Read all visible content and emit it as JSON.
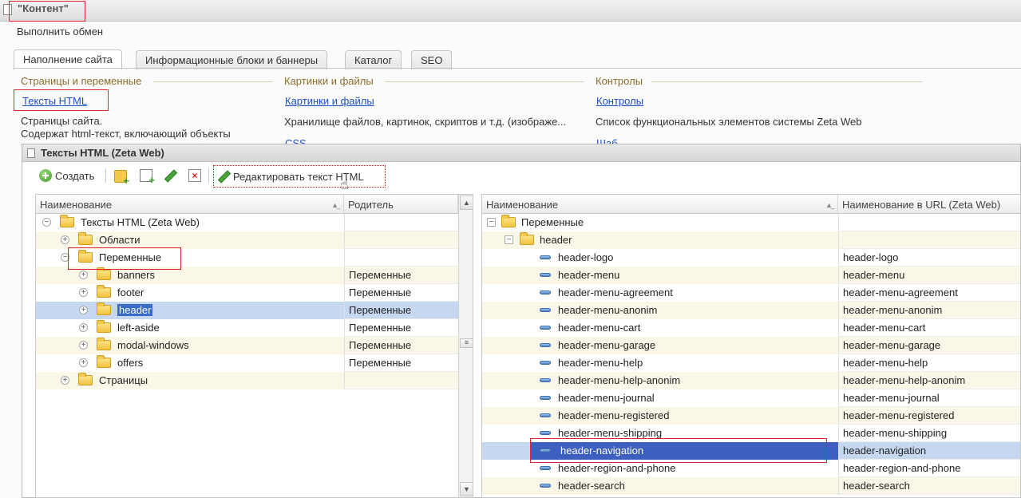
{
  "window": {
    "title": "\"Контент\""
  },
  "top_link": "Выполнить обмен",
  "tabs": [
    {
      "label": "Наполнение сайта",
      "active": true
    },
    {
      "label": "Информационные блоки и баннеры"
    },
    {
      "label": "Каталог"
    },
    {
      "label": "SEO"
    }
  ],
  "sections": [
    {
      "header": "Страницы и переменные",
      "link": "Тексты HTML",
      "desc1": "Страницы сайта.",
      "desc2": "Содержат html-текст, включающий объекты"
    },
    {
      "header": "Картинки и файлы",
      "link": "Картинки и файлы",
      "desc1": "Хранилище файлов, картинок, скриптов и т.д. (изображе...",
      "partial": "CSS"
    },
    {
      "header": "Контролы",
      "link": "Контролы",
      "desc1": "Список функциональных элементов системы Zeta Web",
      "partial": "Шаб"
    }
  ],
  "subwindow": {
    "title": "Тексты HTML (Zeta Web)",
    "toolbar": {
      "create": "Создать",
      "edit_html": "Редактировать текст HTML"
    }
  },
  "left_grid": {
    "columns": [
      "Наименование",
      "Родитель"
    ],
    "rows": [
      {
        "name": "Тексты HTML (Zeta Web)",
        "parent": "",
        "exp": "−"
      },
      {
        "name": "Области",
        "parent": "",
        "exp": "+"
      },
      {
        "name": "Переменные",
        "parent": "",
        "exp": "−"
      },
      {
        "name": "banners",
        "parent": "Переменные",
        "exp": "+"
      },
      {
        "name": "footer",
        "parent": "Переменные",
        "exp": "+"
      },
      {
        "name": "header",
        "parent": "Переменные",
        "exp": "+",
        "selected": true
      },
      {
        "name": "left-aside",
        "parent": "Переменные",
        "exp": "+"
      },
      {
        "name": "modal-windows",
        "parent": "Переменные",
        "exp": "+"
      },
      {
        "name": "offers",
        "parent": "Переменные",
        "exp": "+"
      },
      {
        "name": "Страницы",
        "parent": "",
        "exp": "+"
      }
    ]
  },
  "right_grid": {
    "columns": [
      "Наименование",
      "Наименование  в URL (Zeta Web)"
    ],
    "rows": [
      {
        "name": "Переменные",
        "url": ""
      },
      {
        "name": "header",
        "url": ""
      },
      {
        "name": "header-logo",
        "url": "header-logo"
      },
      {
        "name": "header-menu",
        "url": "header-menu"
      },
      {
        "name": "header-menu-agreement",
        "url": "header-menu-agreement"
      },
      {
        "name": "header-menu-anonim",
        "url": "header-menu-anonim"
      },
      {
        "name": "header-menu-cart",
        "url": "header-menu-cart"
      },
      {
        "name": "header-menu-garage",
        "url": "header-menu-garage"
      },
      {
        "name": "header-menu-help",
        "url": "header-menu-help"
      },
      {
        "name": "header-menu-help-anonim",
        "url": "header-menu-help-anonim"
      },
      {
        "name": "header-menu-journal",
        "url": "header-menu-journal"
      },
      {
        "name": "header-menu-registered",
        "url": "header-menu-registered"
      },
      {
        "name": "header-menu-shipping",
        "url": "header-menu-shipping"
      },
      {
        "name": "header-navigation",
        "url": "header-navigation",
        "selected": true
      },
      {
        "name": "header-region-and-phone",
        "url": "header-region-and-phone"
      },
      {
        "name": "header-search",
        "url": "header-search"
      }
    ]
  }
}
